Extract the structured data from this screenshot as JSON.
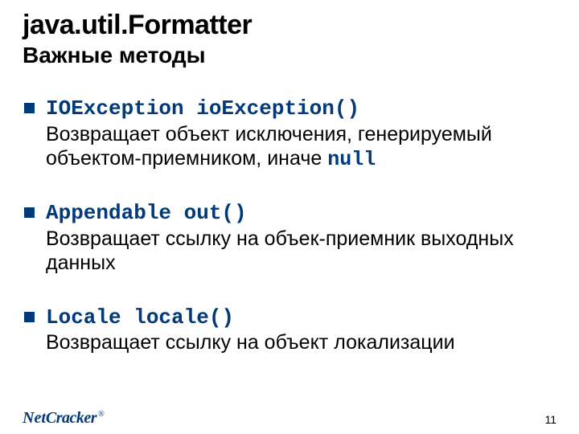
{
  "header": {
    "title": "java.util.Formatter",
    "subtitle": "Важные методы"
  },
  "items": [
    {
      "signature": "IOException ioException()",
      "desc_pre": "Возвращает объект исключения, генерируемый объектом-приемником, иначе ",
      "desc_code": "null",
      "desc_post": ""
    },
    {
      "signature": "Appendable out()",
      "desc_pre": "Возвращает ссылку на объек-приемник выходных данных",
      "desc_code": "",
      "desc_post": ""
    },
    {
      "signature": "Locale locale()",
      "desc_pre": "Возвращает ссылку на объект локализации",
      "desc_code": "",
      "desc_post": ""
    }
  ],
  "footer": {
    "logo_net": "Net",
    "logo_cracker": "Cracker",
    "logo_reg": "®",
    "page": "11"
  }
}
